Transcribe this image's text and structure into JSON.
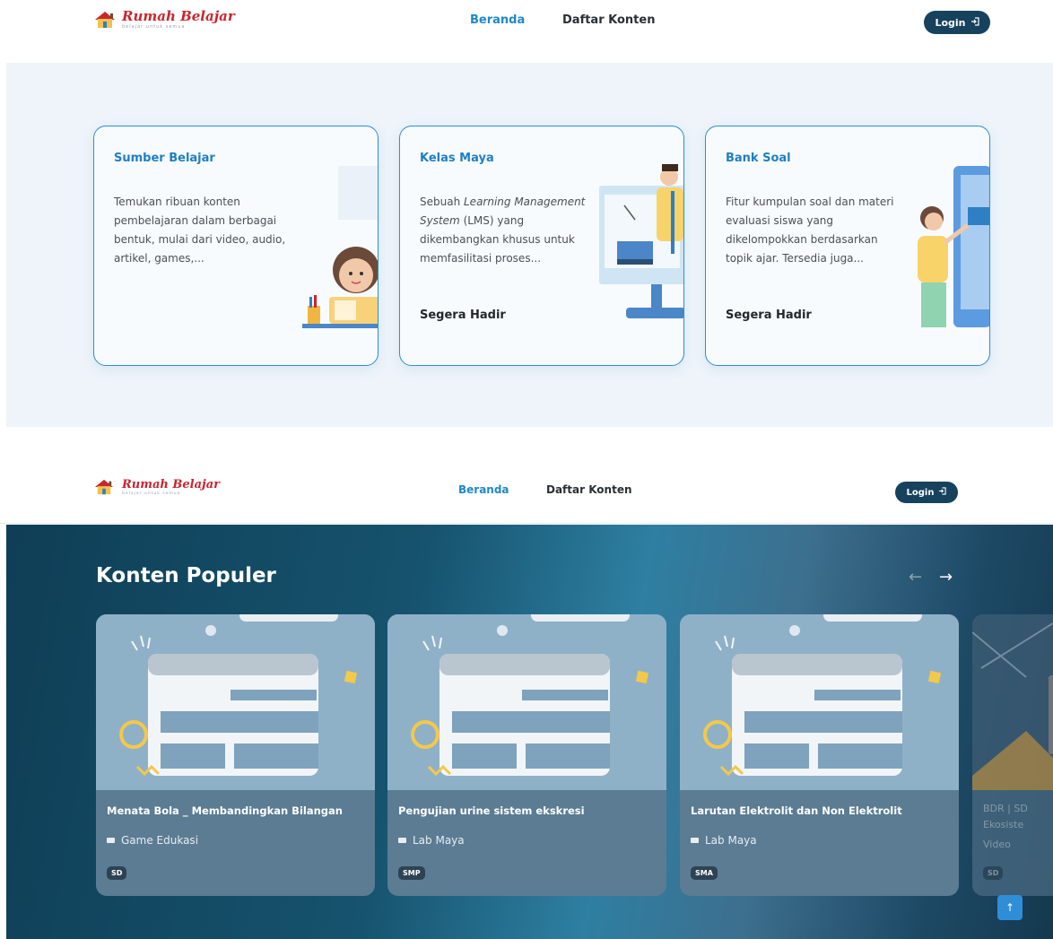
{
  "brand": {
    "name": "Rumah Belajar",
    "tagline": "belajar untuk semua"
  },
  "nav": {
    "home": "Beranda",
    "content_list": "Daftar Konten",
    "login": "Login"
  },
  "features": [
    {
      "title": "Sumber Belajar",
      "desc_parts": [
        "Temukan ribuan konten pembelajaran dalam berbagai bentuk, mulai dari video, audio, artikel, games,..."
      ],
      "soon": ""
    },
    {
      "title": "Kelas Maya",
      "desc_pre": "Sebuah ",
      "desc_em": "Learning Management System",
      "desc_post": " (LMS) yang dikembangkan khusus untuk memfasilitasi proses...",
      "soon": "Segera Hadir"
    },
    {
      "title": "Bank Soal",
      "desc": "Fitur kumpulan soal dan materi evaluasi siswa yang dikelompokkan berdasarkan topik ajar. Tersedia juga...",
      "soon": "Segera Hadir"
    }
  ],
  "popular": {
    "title": "Konten Populer",
    "prev": "←",
    "next": "→",
    "items": [
      {
        "title": "Menata Bola _ Membandingkan Bilangan",
        "type": "Game Edukasi",
        "level": "SD"
      },
      {
        "title": "Pengujian urine sistem ekskresi",
        "type": "Lab Maya",
        "level": "SMP"
      },
      {
        "title": "Larutan Elektrolit dan Non Elektrolit",
        "type": "Lab Maya",
        "level": "SMA"
      }
    ],
    "peek": {
      "line1": "BDR | SD",
      "line2": "Ekosiste",
      "type": "Video",
      "level": "SD"
    }
  },
  "scroll_top_glyph": "↑",
  "colors": {
    "accent": "#1e88c9",
    "login_bg": "#16425d",
    "card_border": "#2d8ed6"
  }
}
